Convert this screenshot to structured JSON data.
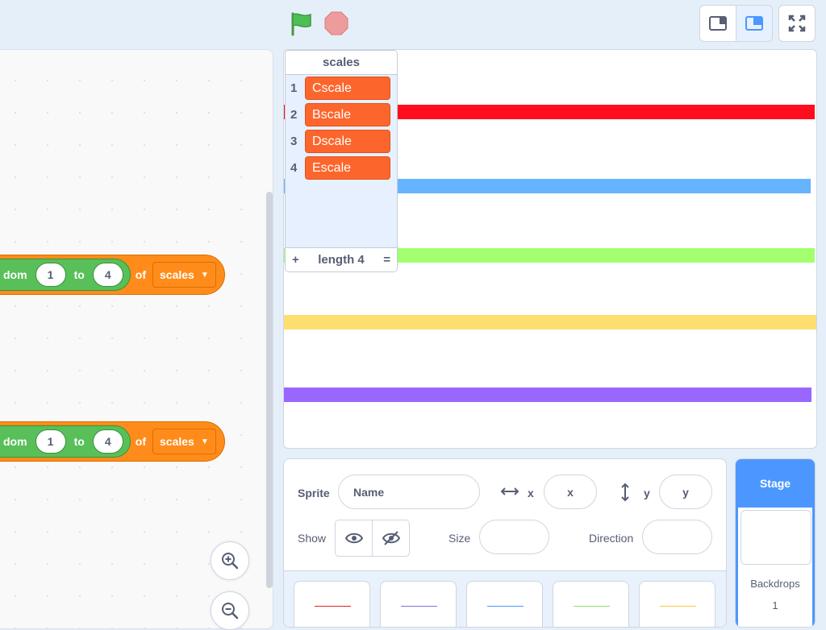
{
  "blocks": [
    {
      "prefix": "dom",
      "from": "1",
      "to_label": "to",
      "to": "4",
      "of_label": "of",
      "list": "scales"
    },
    {
      "prefix": "dom",
      "from": "1",
      "to_label": "to",
      "to": "4",
      "of_label": "of",
      "list": "scales"
    }
  ],
  "list_monitor": {
    "title": "scales",
    "items": [
      {
        "index": "1",
        "value": "Cscale"
      },
      {
        "index": "2",
        "value": "Bscale"
      },
      {
        "index": "3",
        "value": "Dscale"
      },
      {
        "index": "4",
        "value": "Escale"
      }
    ],
    "add_label": "+",
    "length_label": "length 4",
    "resize_label": "="
  },
  "stage_bars": [
    {
      "name": "red",
      "color": "#ff0d1c"
    },
    {
      "name": "blue",
      "color": "#66b3ff"
    },
    {
      "name": "green",
      "color": "#a3ff70"
    },
    {
      "name": "yellow",
      "color": "#ffde70"
    },
    {
      "name": "purple",
      "color": "#9966ff"
    }
  ],
  "sprite_info": {
    "sprite_label": "Sprite",
    "name_placeholder": "Name",
    "x_label": "x",
    "x_placeholder": "x",
    "y_label": "y",
    "y_placeholder": "y",
    "show_label": "Show",
    "size_label": "Size",
    "direction_label": "Direction"
  },
  "sprite_thumbs": [
    {
      "color": "#e02020"
    },
    {
      "color": "#8a6be0"
    },
    {
      "color": "#4c97ff"
    },
    {
      "color": "#8ee36a"
    },
    {
      "color": "#f7c948"
    }
  ],
  "stage_target": {
    "title": "Stage",
    "backdrops_label": "Backdrops",
    "backdrops_count": "1"
  },
  "colors": {
    "accent": "#4c97ff",
    "list_item": "#fc662c",
    "control": "#ff8c1a",
    "operator": "#59c059"
  }
}
